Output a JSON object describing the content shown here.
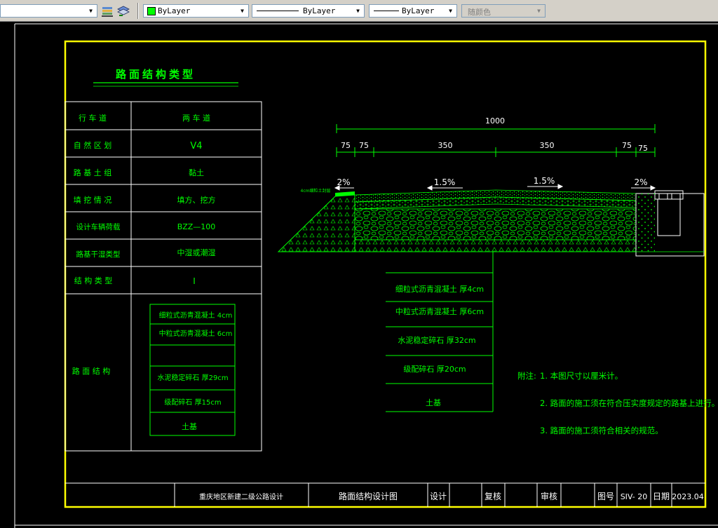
{
  "toolbar": {
    "layer_combo_value": "",
    "color": {
      "label": "ByLayer",
      "swatch": "#00ff00"
    },
    "linetype": {
      "label": "ByLayer"
    },
    "lineweight": {
      "label": "ByLayer"
    },
    "plotstyle": {
      "label": "随颜色"
    }
  },
  "drawing": {
    "title": "路面结构类型",
    "table": {
      "rows": [
        {
          "label": "行 车 道",
          "value": "两 车 道"
        },
        {
          "label": "自 然 区 划",
          "value": "V4"
        },
        {
          "label": "路 基 土 组",
          "value": "黏土"
        },
        {
          "label": "填 挖 情 况",
          "value": "填方、挖方"
        },
        {
          "label": "设计车辆荷载",
          "value": "BZZ—100"
        },
        {
          "label": "路基干湿类型",
          "value": "中湿或潮湿"
        },
        {
          "label": "结 构 类 型",
          "value": "I"
        },
        {
          "label": "路 面 结 构",
          "value": ""
        }
      ],
      "layers": [
        "细粒式沥青混凝土  4cm",
        "中粒式沥青混凝土  6cm",
        "",
        "水泥稳定碎石  厚29cm",
        "级配碎石  厚15cm",
        "土基"
      ]
    },
    "dims": {
      "total": "1000",
      "left_shoulder_1": "75",
      "left_shoulder_2": "75",
      "lane_left": "350",
      "lane_right": "350",
      "right_shoulder_1": "75",
      "right_shoulder_2": "75"
    },
    "slopes": {
      "left": "2%",
      "center_left": "1.5%",
      "center_right": "1.5%",
      "right": "2%"
    },
    "layer_legend": [
      "细粒式沥青混凝土  厚4cm",
      "中粒式沥青混凝土  厚6cm",
      "水泥稳定碎石  厚32cm",
      "级配碎石  厚20cm",
      "土基"
    ],
    "notes": {
      "label": "附注:",
      "items": [
        "1. 本图尺寸以厘米计。",
        "2. 路面的施工须在符合压实度规定的路基上进行。",
        "3. 路面的施工须符合相关的规范。"
      ]
    },
    "title_block": {
      "project": "重庆地区新建二级公路设计",
      "drawing_name": "路面结构设计图",
      "design_label": "设计",
      "check_label": "复核",
      "review_label": "审核",
      "number_label": "图号",
      "number_value": "SIV- 20",
      "date_label": "日期",
      "date_value": "2023.04"
    }
  }
}
